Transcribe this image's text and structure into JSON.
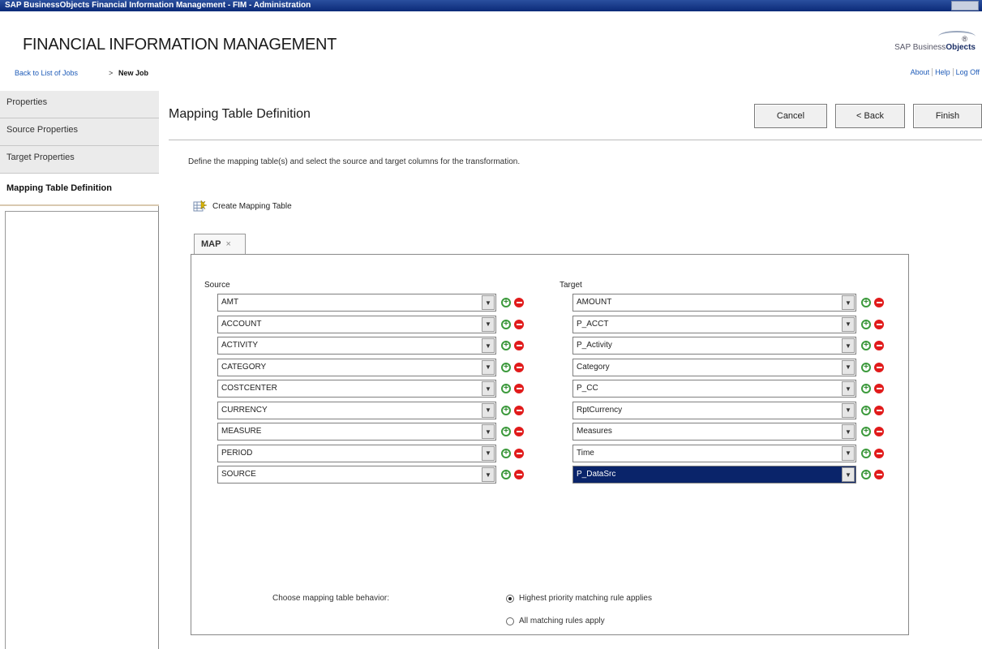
{
  "window": {
    "title": "SAP BusinessObjects Financial Information Management - FIM - Administration"
  },
  "app": {
    "title": "FINANCIAL INFORMATION MANAGEMENT",
    "brand_prefix": "SAP Business",
    "brand_suffix": "Objects"
  },
  "breadcrumb": {
    "back_link": "Back to List of Jobs",
    "separator": ">",
    "current": "New Job"
  },
  "top_links": [
    "About",
    "Help",
    "Log Off"
  ],
  "sidebar": {
    "items": [
      {
        "label": "Properties",
        "active": false
      },
      {
        "label": "Source Properties",
        "active": false
      },
      {
        "label": "Target Properties",
        "active": false
      },
      {
        "label": "Mapping Table Definition",
        "active": true
      }
    ]
  },
  "page": {
    "heading": "Mapping Table Definition",
    "instructions": "Define the mapping table(s) and select the source and target columns for the transformation.",
    "create_link": "Create Mapping Table"
  },
  "buttons": {
    "cancel": "Cancel",
    "back": "< Back",
    "finish": "Finish"
  },
  "tabs": [
    {
      "label": "MAP",
      "close": "×"
    }
  ],
  "mapping": {
    "source_label": "Source",
    "target_label": "Target",
    "source": [
      "AMT",
      "ACCOUNT",
      "ACTIVITY",
      "CATEGORY",
      "COSTCENTER",
      "CURRENCY",
      "MEASURE",
      "PERIOD",
      "SOURCE"
    ],
    "target": [
      "AMOUNT",
      "P_ACCT",
      "P_Activity",
      "Category",
      "P_CC",
      "RptCurrency",
      "Measures",
      "Time",
      "P_DataSrc"
    ],
    "selected_target_index": 8
  },
  "behavior": {
    "label": "Choose mapping table behavior:",
    "options": [
      {
        "label": "Highest priority matching rule applies",
        "checked": true
      },
      {
        "label": "All matching rules apply",
        "checked": false
      }
    ]
  },
  "colors": {
    "accent_selected": "#0a246a",
    "add_icon": "#3c9a3c",
    "remove_icon": "#e11b1b"
  }
}
